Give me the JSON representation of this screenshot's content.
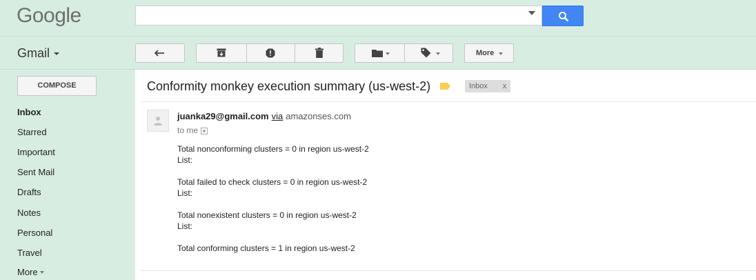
{
  "header": {
    "logo_text": "Google",
    "search": {
      "value": "",
      "placeholder": ""
    }
  },
  "toolbar": {
    "app_label": "Gmail",
    "more_label": "More",
    "icons": [
      "back-arrow-icon",
      "archive-icon",
      "spam-icon",
      "trash-icon",
      "folder-icon",
      "label-icon"
    ]
  },
  "sidebar": {
    "compose_label": "COMPOSE",
    "items": [
      {
        "label": "Inbox",
        "active": true
      },
      {
        "label": "Starred"
      },
      {
        "label": "Important"
      },
      {
        "label": "Sent Mail"
      },
      {
        "label": "Drafts"
      },
      {
        "label": "Notes"
      },
      {
        "label": "Personal"
      },
      {
        "label": "Travel"
      },
      {
        "label": "More"
      }
    ]
  },
  "message": {
    "subject": "Conformity monkey execution summary (us-west-2)",
    "label_chip": "Inbox",
    "label_chip_close": "x",
    "sender_email": "juanka29@gmail.com",
    "via_text": "via",
    "via_domain": "amazonses.com",
    "to_text": "to me",
    "body_lines": [
      "Total nonconforming clusters = 0 in region us-west-2",
      "List:",
      "Total failed to check clusters = 0 in region us-west-2",
      "List:",
      "Total nonexistent clusters = 0 in region us-west-2",
      "List:",
      "Total conforming clusters = 1 in region us-west-2"
    ]
  },
  "colors": {
    "chrome_bg": "#d8ede1",
    "search_button": "#4285f4",
    "tag_color": "#f6cf57"
  }
}
